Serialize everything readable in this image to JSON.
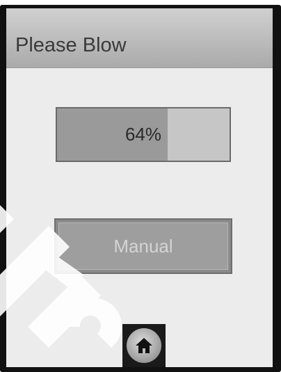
{
  "header": {
    "title": "Please Blow"
  },
  "progress": {
    "value": 64,
    "label": "64%",
    "fill_color": "#9a9a9a",
    "track_color": "#c6c6c6"
  },
  "manual_button": {
    "label": "Manual"
  },
  "home_button": {
    "icon": "home-icon"
  }
}
